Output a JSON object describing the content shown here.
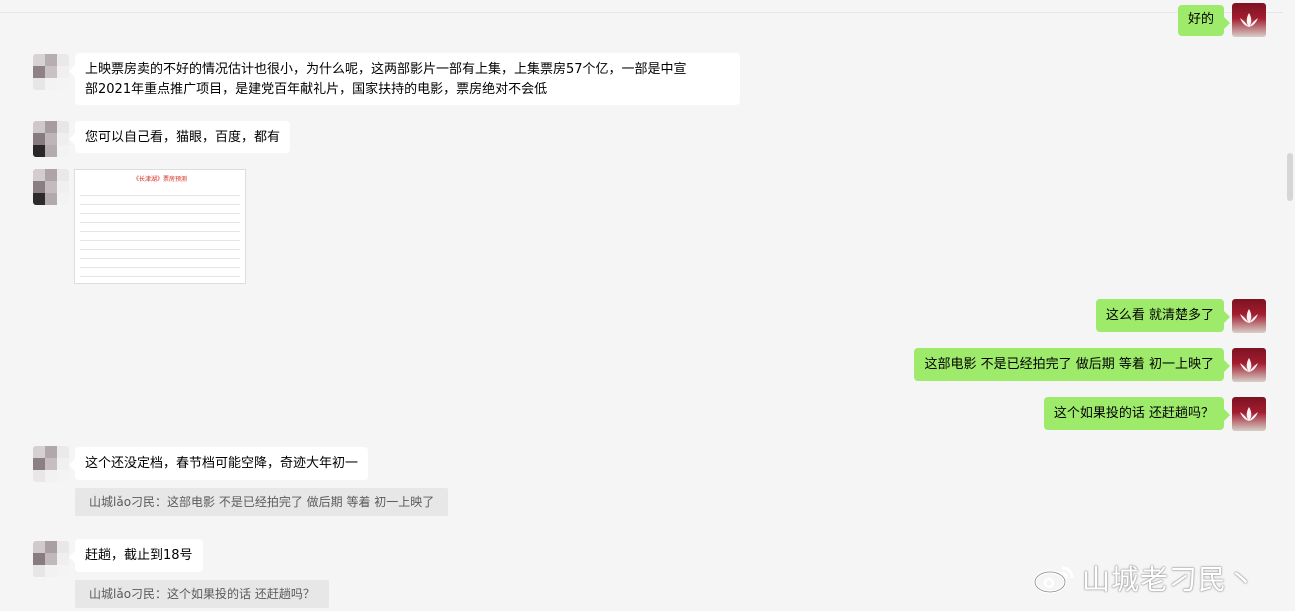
{
  "messages": {
    "m0": "好的",
    "m1": "上映票房卖的不好的情况估计也很小，为什么呢，这两部影片一部有上集，上集票房57个亿，一部是中宣\n部2021年重点推广项目，是建党百年献礼片，国家扶持的电影，票房绝对不会低",
    "m2": "您可以自己看，猫眼，百度，都有",
    "m3": "这么看 就清楚多了",
    "m4": "这部电影 不是已经拍完了 做后期 等着 初一上映了",
    "m5": "这个如果投的话 还赶趟吗？",
    "m6": "这个还没定档，春节档可能空降，奇迹大年初一",
    "q6": "山城lǎo刁民：这部电影 不是已经拍完了 做后期 等着 初一上映了",
    "m7": "赶趟，截止到18号",
    "q7": "山城lǎo刁民：这个如果投的话 还赶趟吗？"
  },
  "image_message": {
    "title": "《长津湖》票房预测"
  },
  "watermark": {
    "text": "山城老刁民丶"
  },
  "colors": {
    "background": "#f5f5f5",
    "incoming_bubble": "#ffffff",
    "outgoing_bubble": "#9eea6a",
    "quote_background": "#e7e7e7"
  }
}
